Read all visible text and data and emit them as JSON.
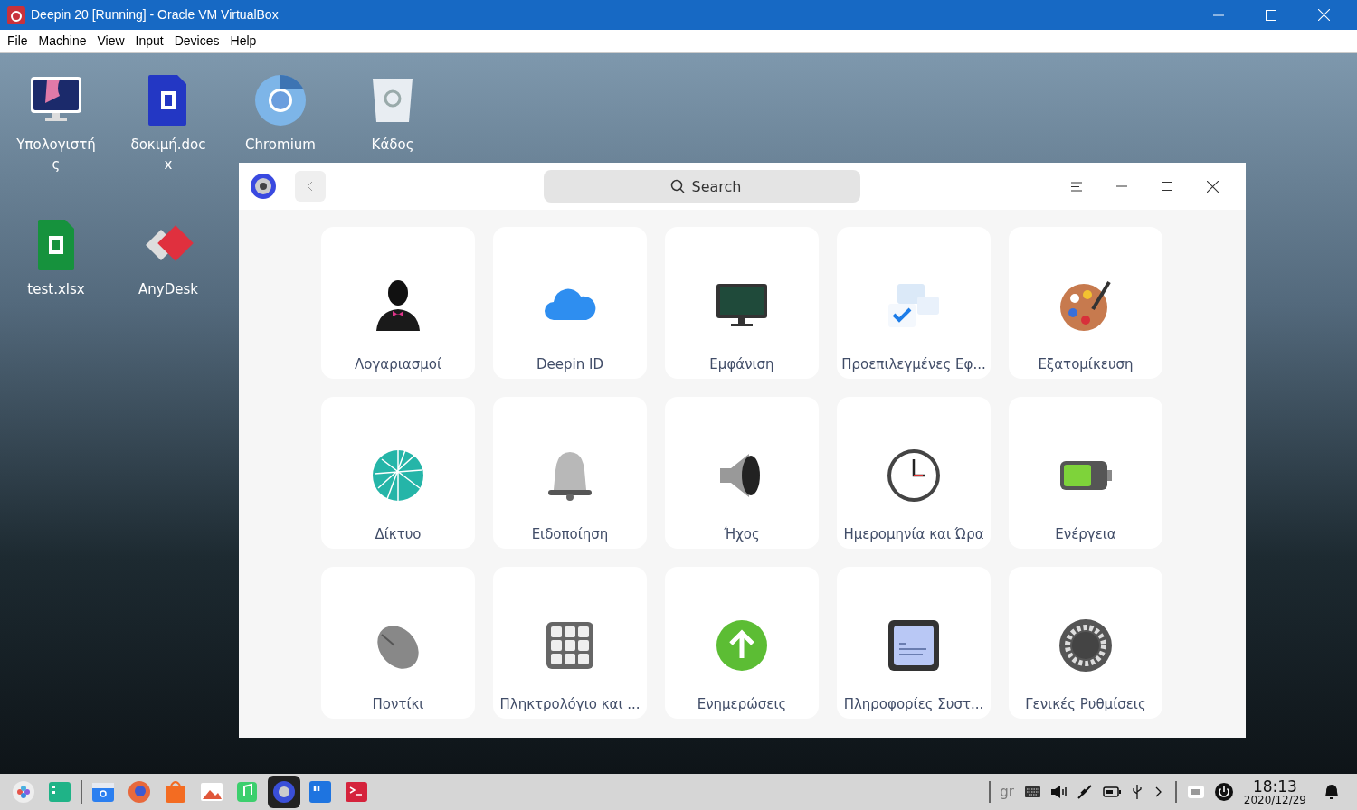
{
  "window": {
    "title": "Deepin 20 [Running] - Oracle VM VirtualBox"
  },
  "menu": [
    "File",
    "Machine",
    "View",
    "Input",
    "Devices",
    "Help"
  ],
  "desktop_icons": [
    {
      "label": "Υπολογιστής",
      "kind": "computer"
    },
    {
      "label": "δοκιμή.docx",
      "kind": "doc"
    },
    {
      "label": "Chromium",
      "kind": "chromium"
    },
    {
      "label": "Κάδος",
      "kind": "trash"
    },
    {
      "label": "test.xlsx",
      "kind": "sheet"
    },
    {
      "label": "AnyDesk",
      "kind": "anydesk"
    }
  ],
  "settings": {
    "search": {
      "placeholder": "Search"
    },
    "tiles": [
      {
        "label": "Λογαριασμοί",
        "kind": "account"
      },
      {
        "label": "Deepin ID",
        "kind": "cloud"
      },
      {
        "label": "Εμφάνιση",
        "kind": "display"
      },
      {
        "label": "Προεπιλεγμένες Εφ...",
        "kind": "apps"
      },
      {
        "label": "Εξατομίκευση",
        "kind": "palette"
      },
      {
        "label": "Δίκτυο",
        "kind": "network"
      },
      {
        "label": "Ειδοποίηση",
        "kind": "bell"
      },
      {
        "label": "Ήχος",
        "kind": "sound"
      },
      {
        "label": "Ημερομηνία και Ώρα",
        "kind": "clock"
      },
      {
        "label": "Ενέργεια",
        "kind": "battery"
      },
      {
        "label": "Ποντίκι",
        "kind": "mouse"
      },
      {
        "label": "Πληκτρολόγιο και ...",
        "kind": "keyboard"
      },
      {
        "label": "Ενημερώσεις",
        "kind": "update"
      },
      {
        "label": "Πληροφορίες Συστ...",
        "kind": "info"
      },
      {
        "label": "Γενικές Ρυθμίσεις",
        "kind": "gear"
      }
    ]
  },
  "dock": [
    {
      "kind": "launcher",
      "selected": false
    },
    {
      "kind": "multitask",
      "selected": false
    },
    {
      "kind": "files",
      "selected": false
    },
    {
      "kind": "firefox",
      "selected": false
    },
    {
      "kind": "store",
      "selected": false
    },
    {
      "kind": "photos",
      "selected": false
    },
    {
      "kind": "music",
      "selected": false
    },
    {
      "kind": "settings",
      "selected": true
    },
    {
      "kind": "notes",
      "selected": false
    },
    {
      "kind": "terminal",
      "selected": false
    }
  ],
  "tray": {
    "layout": "gr",
    "time": "18:13",
    "date": "2020/12/29"
  }
}
